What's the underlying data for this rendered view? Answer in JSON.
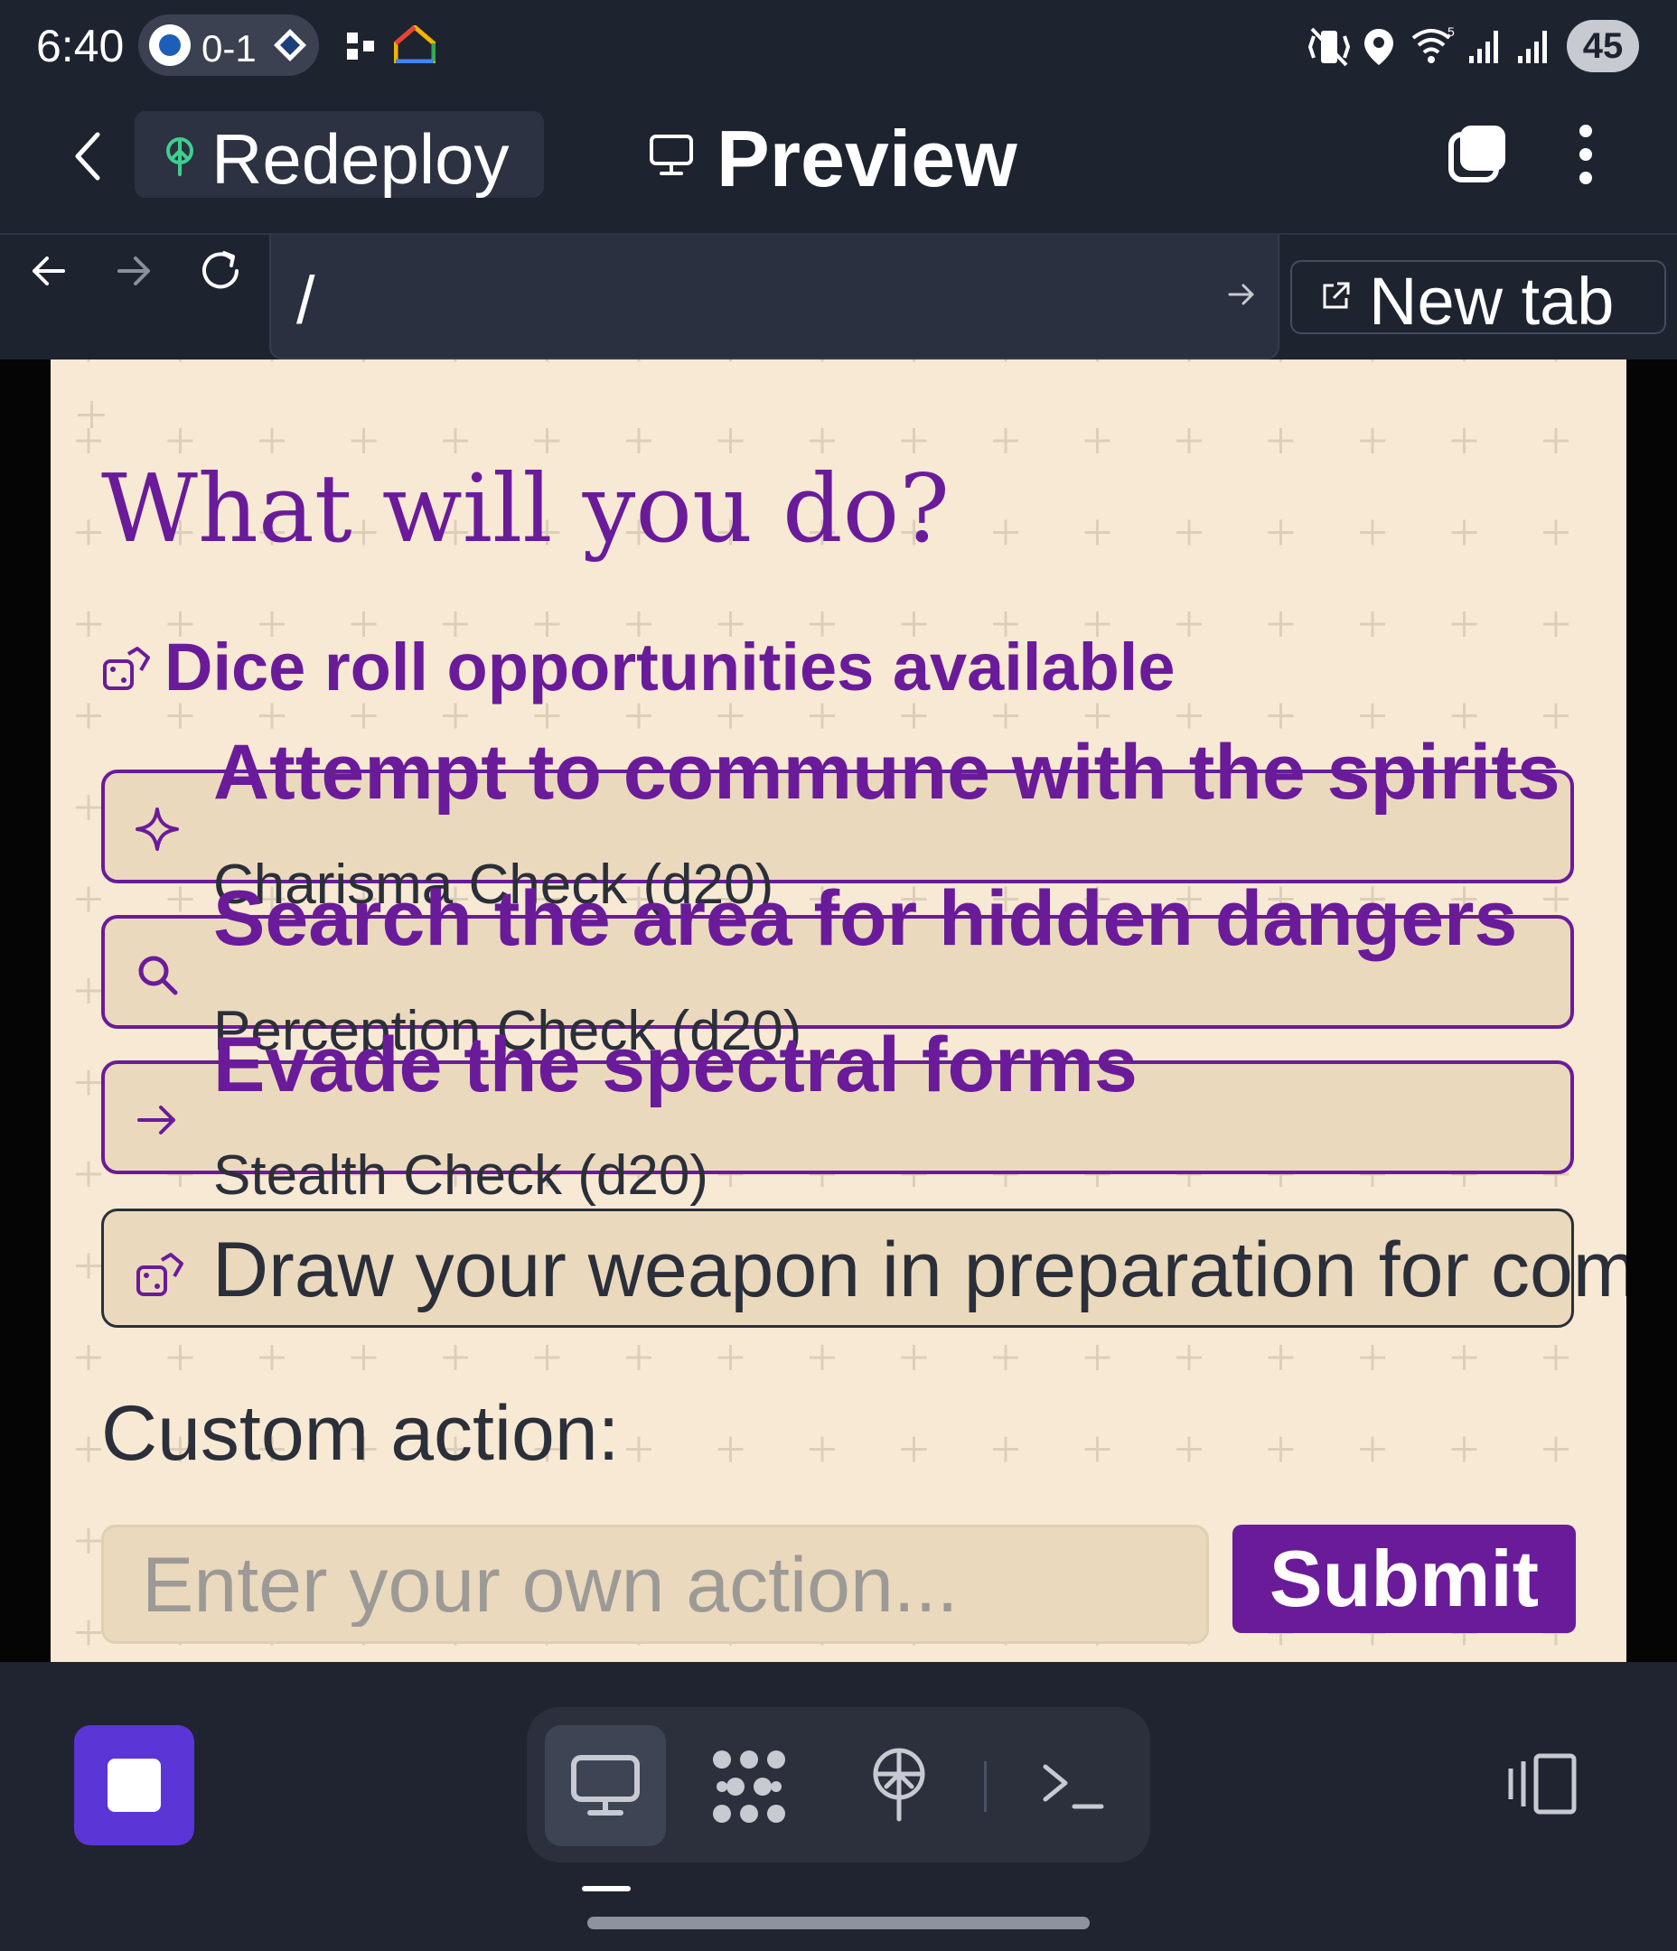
{
  "status_bar": {
    "time": "6:40",
    "score": "0-1",
    "battery": "45",
    "icons": [
      "blue-jays-logo",
      "rays-logo",
      "android-dots-icon",
      "google-home-icon",
      "vibrate-icon",
      "location-icon",
      "wifi-icon",
      "signal-icon",
      "signal-icon"
    ]
  },
  "app_header": {
    "back_icon": "chevron-left-icon",
    "redeploy_label": "Redeploy",
    "redeploy_icon": "deploy-tree-icon",
    "preview_label": "Preview",
    "preview_icon": "monitor-icon",
    "actions": [
      "tabs-icon",
      "more-vertical-icon"
    ]
  },
  "url_bar": {
    "url": "/",
    "go_icon": "arrow-right-icon",
    "new_tab_label": "New tab",
    "new_tab_icon": "external-link-icon"
  },
  "page": {
    "heading": "What will you do?",
    "dice_notice": "Dice roll opportunities available",
    "choices": [
      {
        "title": "Attempt to commune with the spirits",
        "check": "Charisma Check (d20)",
        "icon": "sparkle-icon"
      },
      {
        "title": "Search the area for hidden dangers",
        "check": "Perception Check (d20)",
        "icon": "search-icon"
      },
      {
        "title": "Evade the spectral forms",
        "check": "Stealth Check (d20)",
        "icon": "arrow-right-icon"
      }
    ],
    "plain_choice": "Draw your weapon in preparation for combat",
    "custom_label": "Custom action:",
    "custom_placeholder": "Enter your own action...",
    "submit_label": "Submit"
  },
  "bottom_bar": {
    "dock": [
      "monitor-icon",
      "dots-grid-icon",
      "deploy-tree-icon",
      "terminal-icon"
    ],
    "right_icon": "device-layout-icon"
  },
  "colors": {
    "accent": "#6a1b9a",
    "page_bg": "#f7e9d3",
    "card_bg": "#ebd9bd",
    "chrome_bg": "#1e2330"
  }
}
